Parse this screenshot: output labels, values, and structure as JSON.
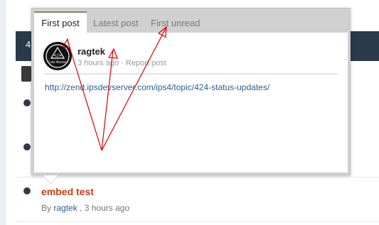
{
  "background": {
    "header_number": "4",
    "topic": {
      "title": "embed test",
      "by_label": "By",
      "author": "ragtek",
      "time_sep": ",",
      "time": "3 hours ago"
    }
  },
  "hovercard": {
    "tabs": [
      {
        "label": "First post",
        "active": true
      },
      {
        "label": "Latest post",
        "active": false
      },
      {
        "label": "First unread",
        "active": false
      }
    ],
    "post": {
      "username": "ragtek",
      "time": "3 hours ago",
      "separator": "·",
      "report_label": "Report post",
      "avatar_text": "Code Monkey",
      "link": "http://zend.ipsdevserver.com/ips4/topic/424-status-updates/"
    }
  },
  "colors": {
    "annotation_arrows": "#dd0000",
    "topic_title": "#c43c12",
    "link": "#2b5f8e"
  }
}
